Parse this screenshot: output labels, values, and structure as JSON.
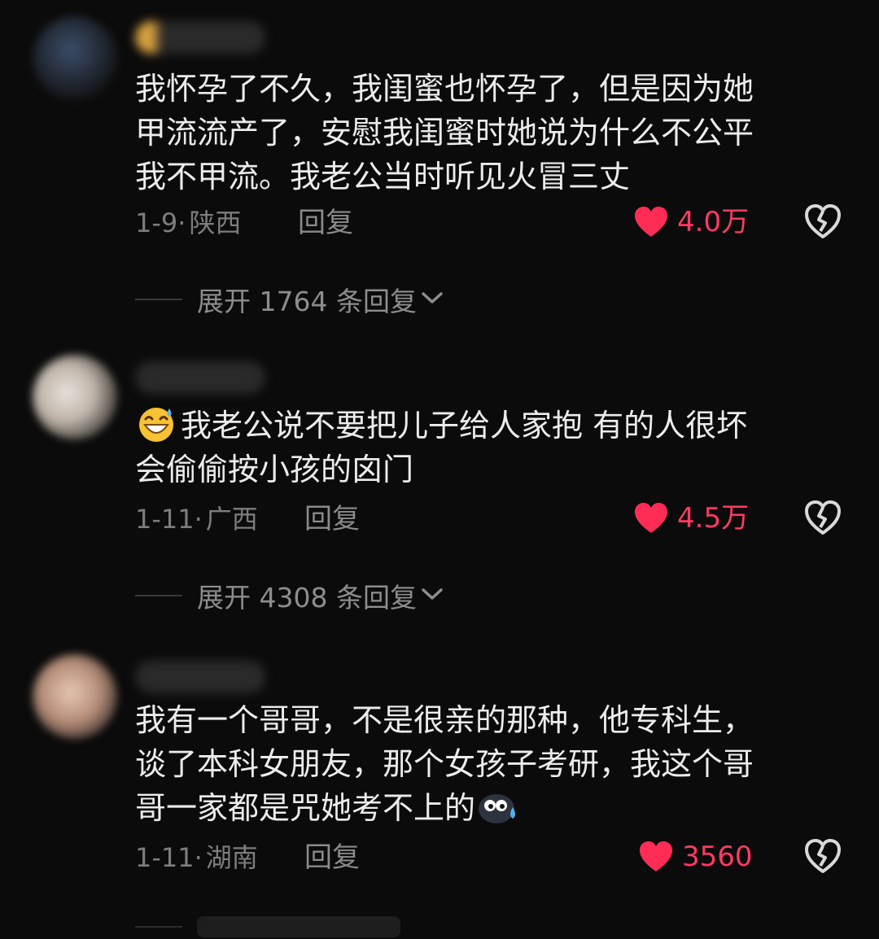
{
  "comments": [
    {
      "text": "我怀孕了不久，我闺蜜也怀孕了，但是因为她甲流流产了，安慰我闺蜜时她说为什么不公平我不甲流。我老公当时听见火冒三丈",
      "lines": [
        "我怀孕了不久，我闺蜜也怀孕了，但是因为她",
        "甲流流产了，安慰我闺蜜时她说为什么不公平",
        "我不甲流。我老公当时听见火冒三丈"
      ],
      "date": "1-9·",
      "location": "陕西",
      "reply_label": "回复",
      "likes": "4.0万",
      "expand_label": "展开 1764 条回复"
    },
    {
      "lines": [
        "我老公说不要把儿子给人家抱 有的人很坏",
        "会偷偷按小孩的囟门"
      ],
      "date": "1-11·",
      "location": "广西",
      "reply_label": "回复",
      "likes": "4.5万",
      "expand_label": "展开 4308 条回复",
      "emoji": "grinning-sweat-emoji"
    },
    {
      "lines": [
        "我有一个哥哥，不是很亲的那种，他专科生，",
        "谈了本科女朋友，那个女孩子考研，我这个哥",
        "哥一家都是咒她考不上的"
      ],
      "date": "1-11·",
      "location": "湖南",
      "reply_label": "回复",
      "likes": "3560",
      "emoji": "crying-blob-emoji"
    }
  ],
  "colors": {
    "background": "#0b0b0b",
    "text": "#ececec",
    "meta": "#7d7d7d",
    "like": "#ff3b63"
  },
  "icons": {
    "like": "heart-icon",
    "dislike": "broken-heart-icon",
    "expand": "chevron-down-icon"
  }
}
